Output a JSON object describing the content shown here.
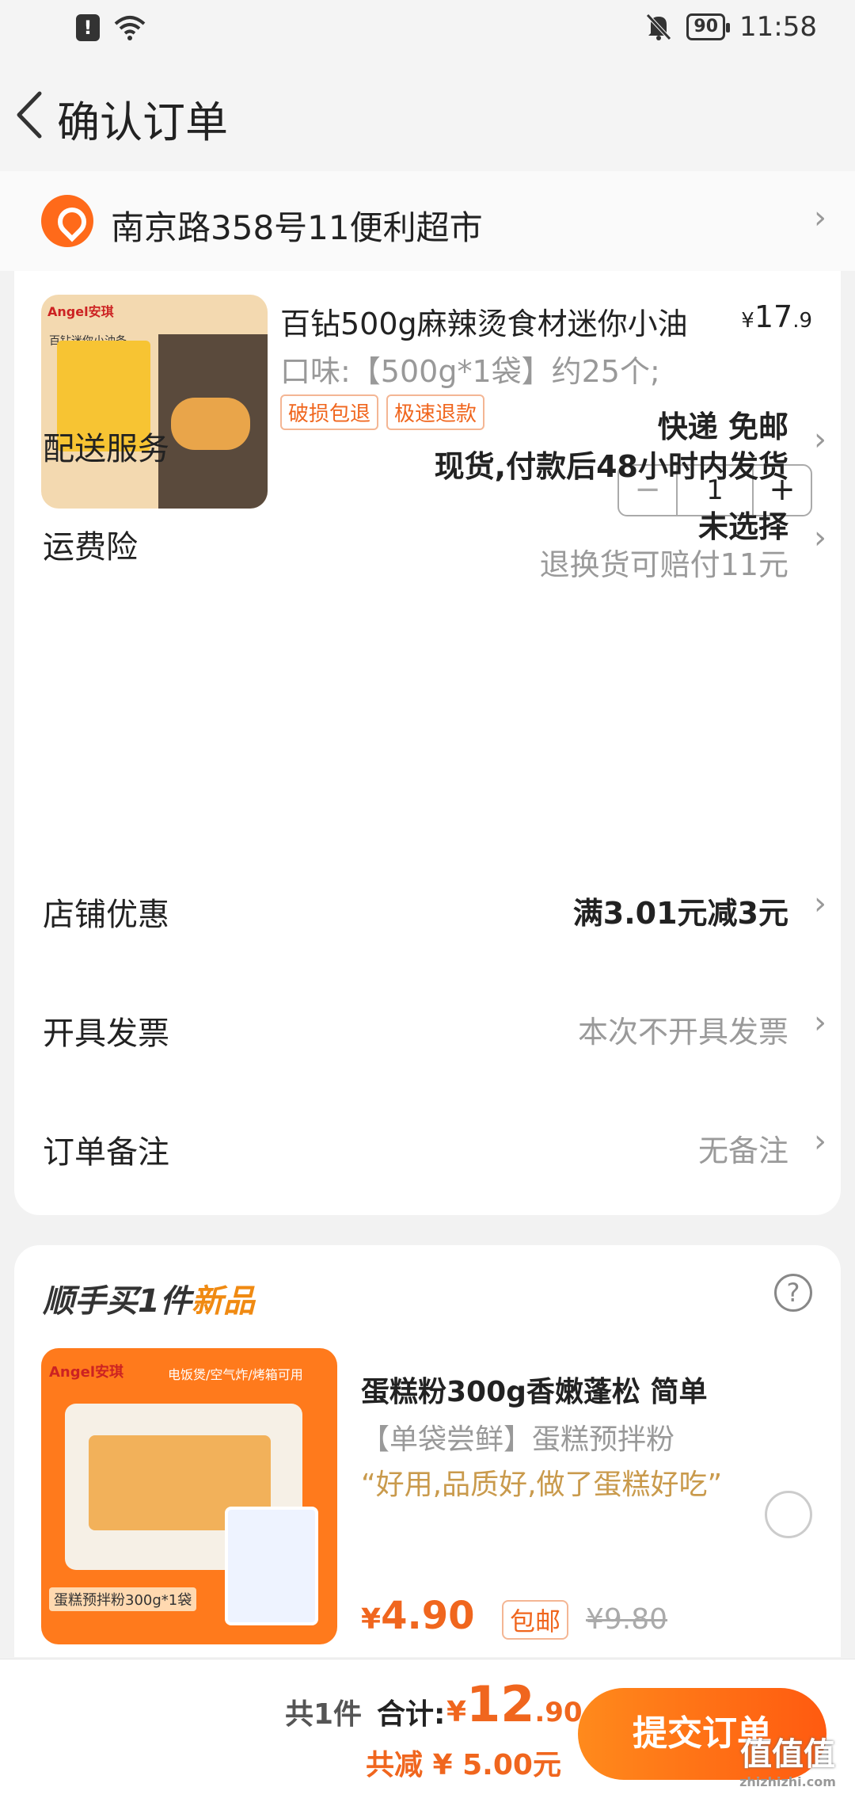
{
  "status_bar": {
    "time": "11:58",
    "battery": "90",
    "alert_glyph": "!",
    "icons": [
      "alert-icon",
      "wifi-icon",
      "mute-bell-icon",
      "battery-icon"
    ]
  },
  "header": {
    "title": "确认订单"
  },
  "address": {
    "text": "南京路358号11便利超市"
  },
  "product": {
    "title": "百钻500g麻辣烫食材迷你小油",
    "price_currency": "¥",
    "price_int": "17",
    "price_dec": ".9",
    "spec": "口味:【500g*1袋】约25个;",
    "tags": [
      "破损包退",
      "极速退款"
    ],
    "quantity": "1",
    "minus": "−",
    "plus": "+",
    "image_brand": "Angel安琪",
    "image_caption": "百钻迷你小油条"
  },
  "rows": {
    "delivery": {
      "label": "配送服务",
      "line1": "快递 免邮",
      "line2": "现货,付款后48小时内发货"
    },
    "insurance": {
      "label": "运费险",
      "line1": "未选择",
      "line2": "退换货可赔付11元"
    },
    "shop_discount": {
      "label": "店铺优惠",
      "value": "满3.01元减3元"
    },
    "invoice": {
      "label": "开具发票",
      "value": "本次不开具发票"
    },
    "remark": {
      "label": "订单备注",
      "value": "无备注"
    }
  },
  "recommend": {
    "title_prefix": "顺手买1件",
    "title_new": "新品",
    "help": "?",
    "item_title": "蛋糕粉300g香嫩蓬松 简单",
    "item_sub": "【单袋尝鲜】蛋糕预拌粉",
    "item_quote": "“好用,品质好,做了蛋糕好吃”",
    "price_currency": "¥",
    "price": "4.90",
    "badge": "包邮",
    "original_price": "¥9.80",
    "image_brand": "Angel安琪",
    "image_banner": "电饭煲/空气炸/烤箱可用",
    "image_caption": "蛋糕预拌粉300g*1袋"
  },
  "bottom_bar": {
    "count": "共1件",
    "total_label": "合计:",
    "total_currency": "¥",
    "total_int": "12",
    "total_dec": ".90",
    "saved": "共减 ¥ 5.00元",
    "submit": "提交订单"
  },
  "watermark": {
    "big": "值值值",
    "small": "zhizhizhi.com"
  },
  "colors": {
    "accent": "#f0661e",
    "background": "#f2f2f2",
    "card": "#ffffff"
  }
}
